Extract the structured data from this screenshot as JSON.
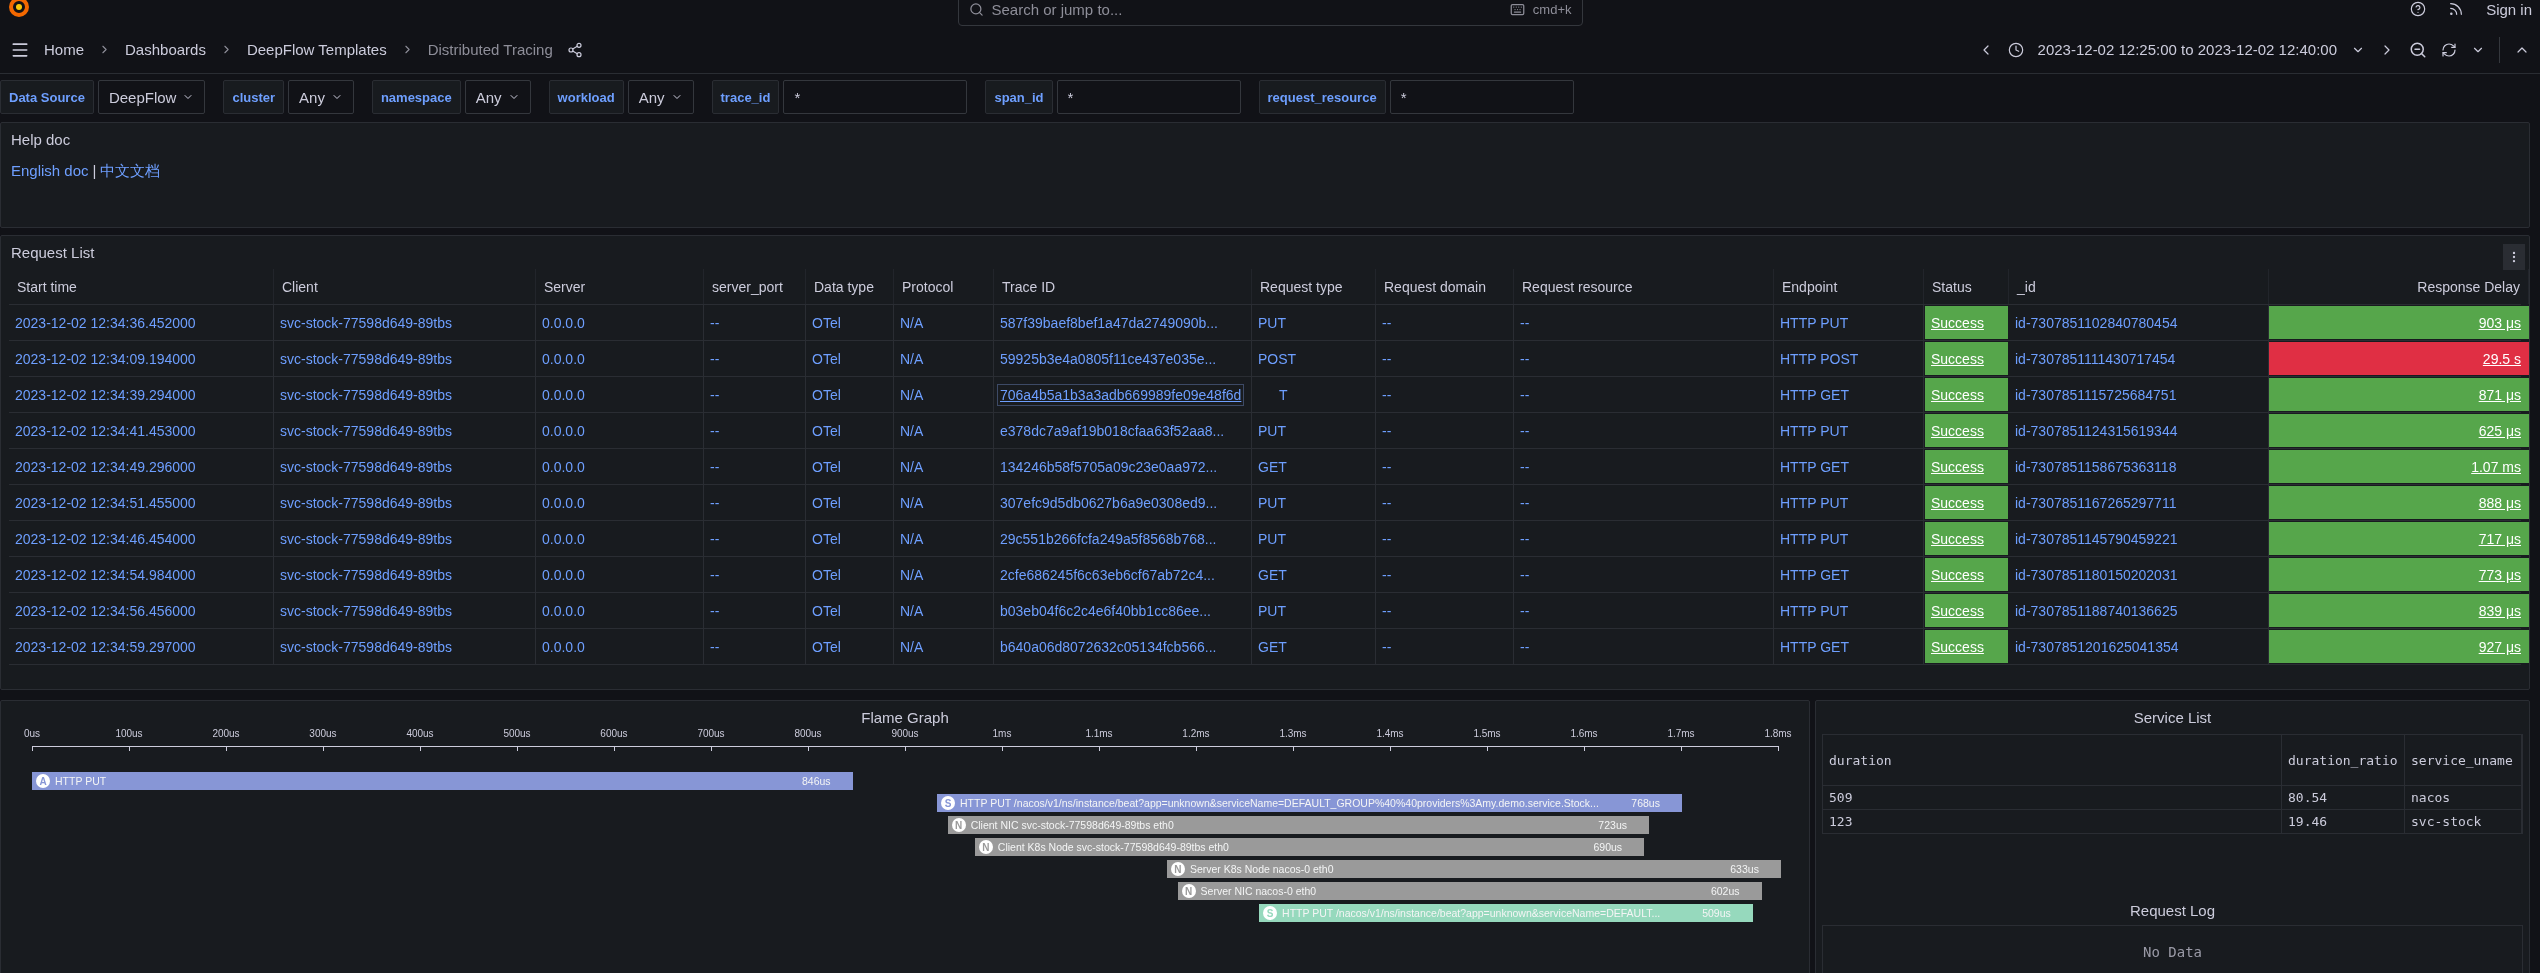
{
  "top_bar": {
    "search": {
      "placeholder": "Search or jump to...",
      "shortcut": "cmd+k"
    },
    "sign_in": "Sign in"
  },
  "breadcrumbs": [
    {
      "label": "Home",
      "current": false
    },
    {
      "label": "Dashboards",
      "current": false
    },
    {
      "label": "DeepFlow Templates",
      "current": false
    },
    {
      "label": "Distributed Tracing",
      "current": true
    }
  ],
  "time_range": "2023-12-02 12:25:00 to 2023-12-02 12:40:00",
  "variables": [
    {
      "kind": "select",
      "label": "Data Source",
      "value": "DeepFlow"
    },
    {
      "kind": "select",
      "label": "cluster",
      "value": "Any"
    },
    {
      "kind": "select",
      "label": "namespace",
      "value": "Any"
    },
    {
      "kind": "select",
      "label": "workload",
      "value": "Any"
    },
    {
      "kind": "input",
      "label": "trace_id",
      "value": "*"
    },
    {
      "kind": "input",
      "label": "span_id",
      "value": "*"
    },
    {
      "kind": "input",
      "label": "request_resource",
      "value": "*"
    }
  ],
  "help_doc": {
    "title": "Help doc",
    "links": [
      "English doc",
      "中文文档"
    ],
    "separator": "|"
  },
  "request_list": {
    "title": "Request List",
    "columns": [
      "Start time",
      "Client",
      "Server",
      "server_port",
      "Data type",
      "Protocol",
      "Trace ID",
      "Request type",
      "Request domain",
      "Request resource",
      "Endpoint",
      "Status",
      "_id",
      "Response Delay"
    ],
    "rows": [
      {
        "cells": [
          "2023-12-02 12:34:36.452000",
          "svc-stock-77598d649-89tbs",
          "0.0.0.0",
          "--",
          "OTel",
          "N/A",
          "587f39baef8bef1a47da2749090b...",
          "PUT",
          "--",
          "--",
          "HTTP PUT",
          "Success",
          "id-7307851102840780454",
          "903 μs"
        ],
        "trace_hovered": false,
        "color": "#56a64b"
      },
      {
        "cells": [
          "2023-12-02 12:34:09.194000",
          "svc-stock-77598d649-89tbs",
          "0.0.0.0",
          "--",
          "OTel",
          "N/A",
          "59925b3e4a0805f11ce437e035e...",
          "POST",
          "--",
          "--",
          "HTTP POST",
          "Success",
          "id-7307851111430717454",
          "29.5 s"
        ],
        "trace_hovered": false,
        "color": "#e02f44"
      },
      {
        "cells": [
          "2023-12-02 12:34:39.294000",
          "svc-stock-77598d649-89tbs",
          "0.0.0.0",
          "--",
          "OTel",
          "N/A",
          "706a4b5a1b3a3adb669989fe09e48f6d",
          "T",
          "--",
          "--",
          "HTTP GET",
          "Success",
          "id-7307851115725684751",
          "871 μs"
        ],
        "trace_hovered": true,
        "color": "#56a64b"
      },
      {
        "cells": [
          "2023-12-02 12:34:41.453000",
          "svc-stock-77598d649-89tbs",
          "0.0.0.0",
          "--",
          "OTel",
          "N/A",
          "e378dc7a9af19b018cfaa63f52aa8...",
          "PUT",
          "--",
          "--",
          "HTTP PUT",
          "Success",
          "id-7307851124315619344",
          "625 μs"
        ],
        "trace_hovered": false,
        "color": "#56a64b"
      },
      {
        "cells": [
          "2023-12-02 12:34:49.296000",
          "svc-stock-77598d649-89tbs",
          "0.0.0.0",
          "--",
          "OTel",
          "N/A",
          "134246b58f5705a09c23e0aa972...",
          "GET",
          "--",
          "--",
          "HTTP GET",
          "Success",
          "id-7307851158675363118",
          "1.07 ms"
        ],
        "trace_hovered": false,
        "color": "#56a64b"
      },
      {
        "cells": [
          "2023-12-02 12:34:51.455000",
          "svc-stock-77598d649-89tbs",
          "0.0.0.0",
          "--",
          "OTel",
          "N/A",
          "307efc9d5db0627b6a9e0308ed9...",
          "PUT",
          "--",
          "--",
          "HTTP PUT",
          "Success",
          "id-7307851167265297711",
          "888 μs"
        ],
        "trace_hovered": false,
        "color": "#56a64b"
      },
      {
        "cells": [
          "2023-12-02 12:34:46.454000",
          "svc-stock-77598d649-89tbs",
          "0.0.0.0",
          "--",
          "OTel",
          "N/A",
          "29c551b266fcfa249a5f8568b768...",
          "PUT",
          "--",
          "--",
          "HTTP PUT",
          "Success",
          "id-7307851145790459221",
          "717 μs"
        ],
        "trace_hovered": false,
        "color": "#56a64b"
      },
      {
        "cells": [
          "2023-12-02 12:34:54.984000",
          "svc-stock-77598d649-89tbs",
          "0.0.0.0",
          "--",
          "OTel",
          "N/A",
          "2cfe686245f6c63eb6cf67ab72c4...",
          "GET",
          "--",
          "--",
          "HTTP GET",
          "Success",
          "id-7307851180150202031",
          "773 μs"
        ],
        "trace_hovered": false,
        "color": "#56a64b"
      },
      {
        "cells": [
          "2023-12-02 12:34:56.456000",
          "svc-stock-77598d649-89tbs",
          "0.0.0.0",
          "--",
          "OTel",
          "N/A",
          "b03eb04f6c2c4e6f40bb1cc86ee...",
          "PUT",
          "--",
          "--",
          "HTTP PUT",
          "Success",
          "id-7307851188740136625",
          "839 μs"
        ],
        "trace_hovered": false,
        "color": "#56a64b"
      },
      {
        "cells": [
          "2023-12-02 12:34:59.297000",
          "svc-stock-77598d649-89tbs",
          "0.0.0.0",
          "--",
          "OTel",
          "N/A",
          "b640a06d8072632c05134fcb566...",
          "GET",
          "--",
          "--",
          "HTTP GET",
          "Success",
          "id-7307851201625041354",
          "927 μs"
        ],
        "trace_hovered": false,
        "color": "#56a64b"
      }
    ]
  },
  "flame_graph": {
    "title": "Flame Graph",
    "ticks": [
      "0us",
      "100us",
      "200us",
      "300us",
      "400us",
      "500us",
      "600us",
      "700us",
      "800us",
      "900us",
      "1ms",
      "1.1ms",
      "1.2ms",
      "1.3ms",
      "1.4ms",
      "1.5ms",
      "1.6ms",
      "1.7ms",
      "1.8ms"
    ],
    "spans": [
      {
        "badge": "A",
        "label": "HTTP PUT",
        "duration": "846us",
        "color": "#8796d6"
      },
      {
        "badge": "S",
        "label": "HTTP PUT /nacos/v1/ns/instance/beat?app=unknown&serviceName=DEFAULT_GROUP%40%40providers%3Amy.demo.service.Stock...",
        "duration": "768us",
        "color": "#8796d6"
      },
      {
        "badge": "N",
        "label": "Client NIC svc-stock-77598d649-89tbs eth0",
        "duration": "723us",
        "color": "#9a9a9a"
      },
      {
        "badge": "N",
        "label": "Client K8s Node svc-stock-77598d649-89tbs eth0",
        "duration": "690us",
        "color": "#9a9a9a"
      },
      {
        "badge": "N",
        "label": "Server K8s Node nacos-0 eth0",
        "duration": "633us",
        "color": "#9a9a9a"
      },
      {
        "badge": "N",
        "label": "Server NIC nacos-0 eth0",
        "duration": "602us",
        "color": "#9a9a9a"
      },
      {
        "badge": "S",
        "label": "HTTP PUT /nacos/v1/ns/instance/beat?app=unknown&serviceName=DEFAULT...",
        "duration": "509us",
        "color": "#96d9bd"
      }
    ]
  },
  "service_list": {
    "title": "Service List",
    "columns": [
      "duration",
      "duration_ratio",
      "service_uname"
    ],
    "rows": [
      [
        "509",
        "80.54",
        "nacos"
      ],
      [
        "123",
        "19.46",
        "svc-stock"
      ]
    ]
  },
  "request_log": {
    "title": "Request Log",
    "empty_text": "No Data"
  }
}
